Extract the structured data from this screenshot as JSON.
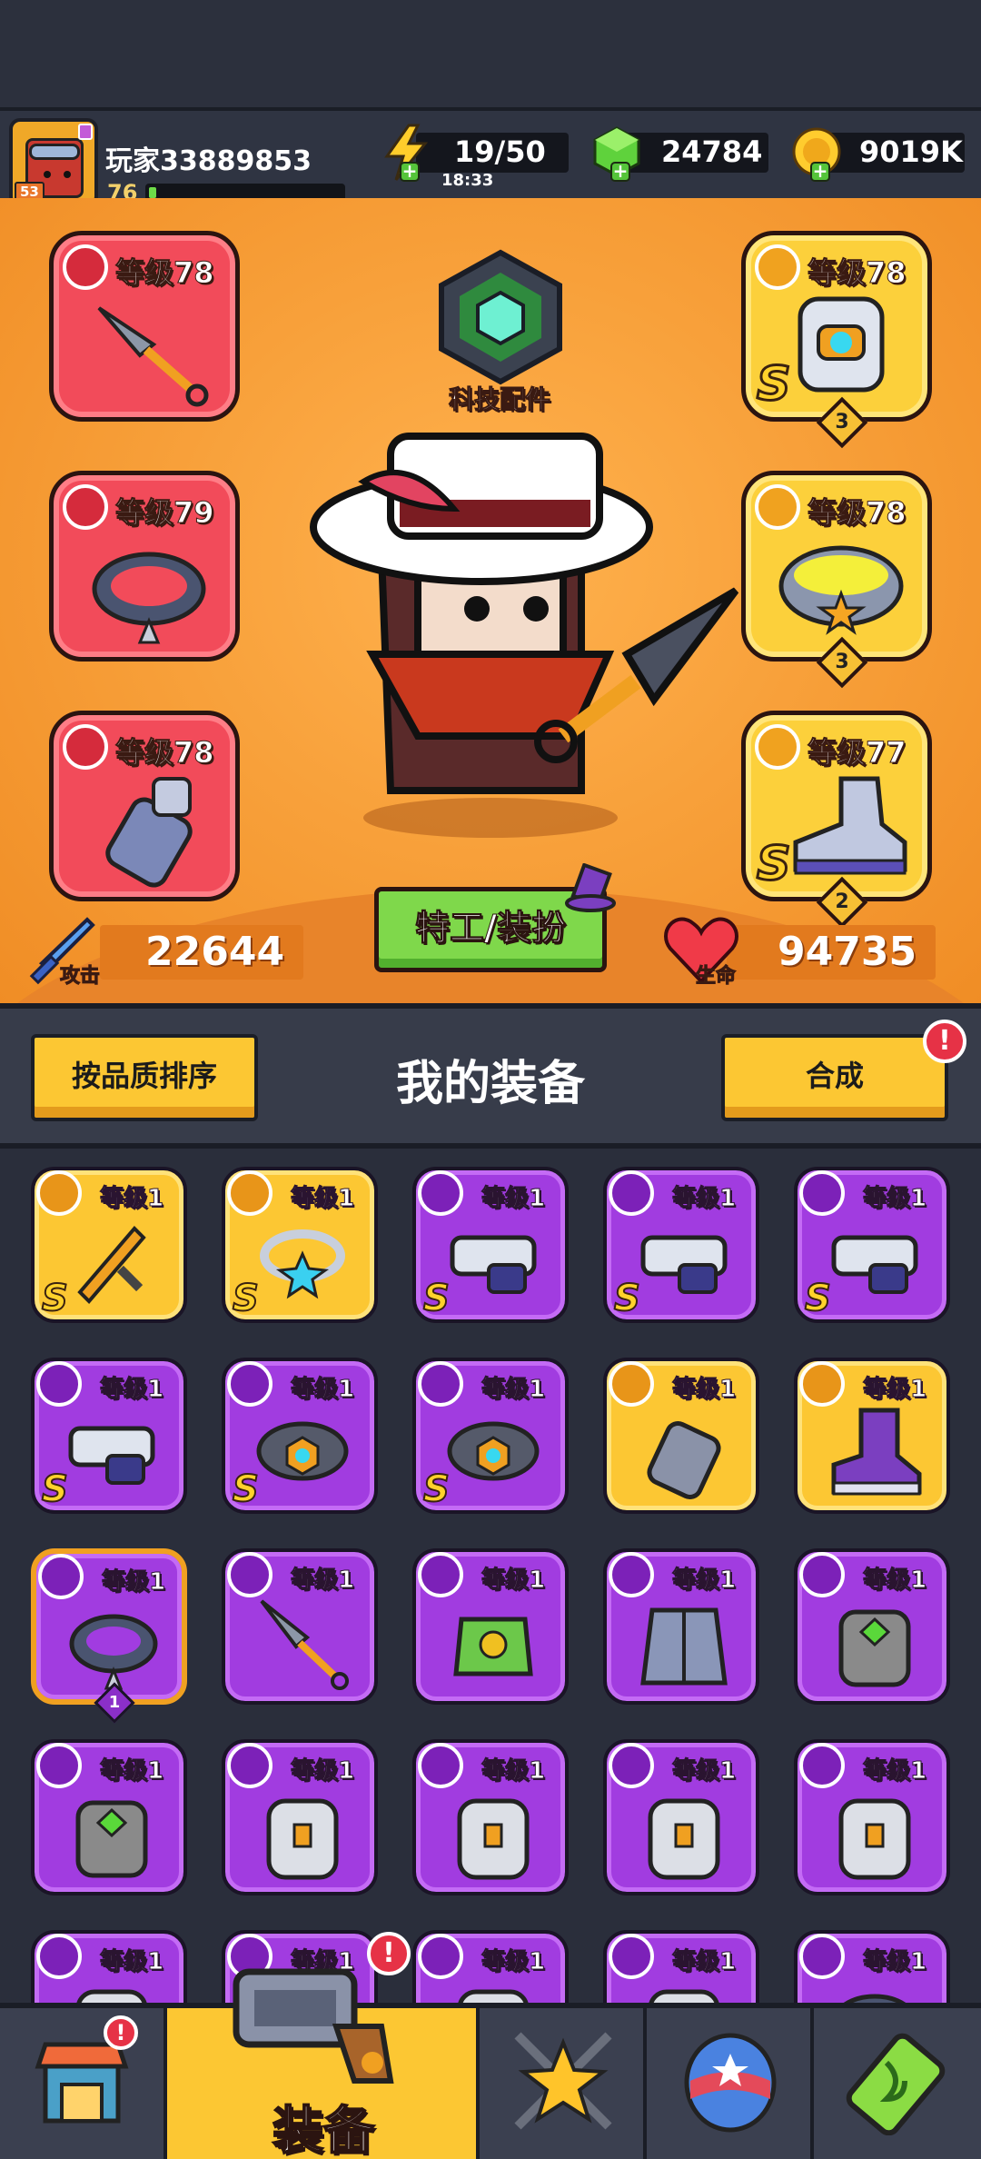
{
  "player": {
    "name": "玩家33889853",
    "avatar_level": "53",
    "level": "76",
    "xp_fraction": 0.04
  },
  "resources": {
    "energy": "19/50",
    "energy_timer": "18:33",
    "gems": "24784",
    "coins": "9019K"
  },
  "hero": {
    "tech_label": "科技配件",
    "agent_button": "特工/装扮",
    "attack_label": "攻击",
    "attack_value": "22644",
    "hp_label": "生命",
    "hp_value": "94735",
    "slots": [
      {
        "name": "weapon",
        "level": "等级78",
        "color": "red",
        "badge_icon": "gun-icon",
        "item_icon": "kunai-icon"
      },
      {
        "name": "necklace",
        "level": "等级79",
        "color": "red",
        "badge_icon": "necklace-icon",
        "item_icon": "spiked-collar-icon"
      },
      {
        "name": "gloves",
        "level": "等级78",
        "color": "red",
        "badge_icon": "hand-icon",
        "item_icon": "gauntlet-icon"
      },
      {
        "name": "armor",
        "level": "等级78",
        "color": "gold",
        "badge_icon": "shirt-icon",
        "item_icon": "robot-armor-icon",
        "grade": "S",
        "count": "3"
      },
      {
        "name": "belt",
        "level": "等级78",
        "color": "gold",
        "badge_icon": "belt-icon",
        "item_icon": "star-belt-icon",
        "grade": "",
        "count": "3"
      },
      {
        "name": "boots",
        "level": "等级77",
        "color": "gold",
        "badge_icon": "boot-icon",
        "item_icon": "sneaker-icon",
        "grade": "S",
        "count": "2"
      }
    ]
  },
  "inventory": {
    "sort_button": "按品质排序",
    "title": "我的装备",
    "merge_button": "合成",
    "merge_alert": "!",
    "items": [
      {
        "level": "等级1",
        "color": "gold",
        "grade": "S",
        "icon": "sword-icon"
      },
      {
        "level": "等级1",
        "color": "gold",
        "grade": "S",
        "icon": "ring-icon"
      },
      {
        "level": "等级1",
        "color": "purple",
        "grade": "S",
        "icon": "blaster-icon"
      },
      {
        "level": "等级1",
        "color": "purple",
        "grade": "S",
        "icon": "blaster-icon"
      },
      {
        "level": "等级1",
        "color": "purple",
        "grade": "S",
        "icon": "blaster-icon"
      },
      {
        "level": "等级1",
        "color": "purple",
        "grade": "S",
        "icon": "blaster-icon"
      },
      {
        "level": "等级1",
        "color": "purple",
        "grade": "S",
        "icon": "hex-belt-icon"
      },
      {
        "level": "等级1",
        "color": "purple",
        "grade": "S",
        "icon": "hex-belt-icon"
      },
      {
        "level": "等级1",
        "color": "gold",
        "grade": "",
        "icon": "gauntlet-icon"
      },
      {
        "level": "等级1",
        "color": "gold",
        "grade": "",
        "icon": "boot-icon"
      },
      {
        "level": "等级1",
        "color": "purple",
        "grade": "",
        "icon": "spiked-collar-icon",
        "count": "1",
        "selected": true
      },
      {
        "level": "等级1",
        "color": "purple",
        "grade": "",
        "icon": "kunai-icon"
      },
      {
        "level": "等级1",
        "color": "purple",
        "grade": "",
        "icon": "leaf-armor-icon"
      },
      {
        "level": "等级1",
        "color": "purple",
        "grade": "",
        "icon": "coat-icon"
      },
      {
        "level": "等级1",
        "color": "purple",
        "grade": "",
        "icon": "gem-armor-icon"
      },
      {
        "level": "等级1",
        "color": "purple",
        "grade": "",
        "icon": "gem-armor-icon"
      },
      {
        "level": "等级1",
        "color": "purple",
        "grade": "",
        "icon": "plate-armor-icon"
      },
      {
        "level": "等级1",
        "color": "purple",
        "grade": "",
        "icon": "plate-armor-icon"
      },
      {
        "level": "等级1",
        "color": "purple",
        "grade": "",
        "icon": "plate-armor-icon"
      },
      {
        "level": "等级1",
        "color": "purple",
        "grade": "",
        "icon": "plate-armor-icon"
      },
      {
        "level": "等级1",
        "color": "purple",
        "grade": "",
        "icon": "plate-armor-icon"
      },
      {
        "level": "等级1",
        "color": "purple",
        "grade": "",
        "icon": "plate-armor-icon"
      },
      {
        "level": "等级1",
        "color": "purple",
        "grade": "",
        "icon": "plate-armor-icon"
      },
      {
        "level": "等级1",
        "color": "purple",
        "grade": "",
        "icon": "plate-armor-icon"
      },
      {
        "level": "等级1",
        "color": "purple",
        "grade": "",
        "icon": "spiked-collar-icon"
      }
    ]
  },
  "nav": {
    "active_label": "装备",
    "alert": "!",
    "items": [
      "shop-icon",
      "equipment-icon",
      "battle-icon",
      "egg-icon",
      "battery-icon"
    ]
  }
}
